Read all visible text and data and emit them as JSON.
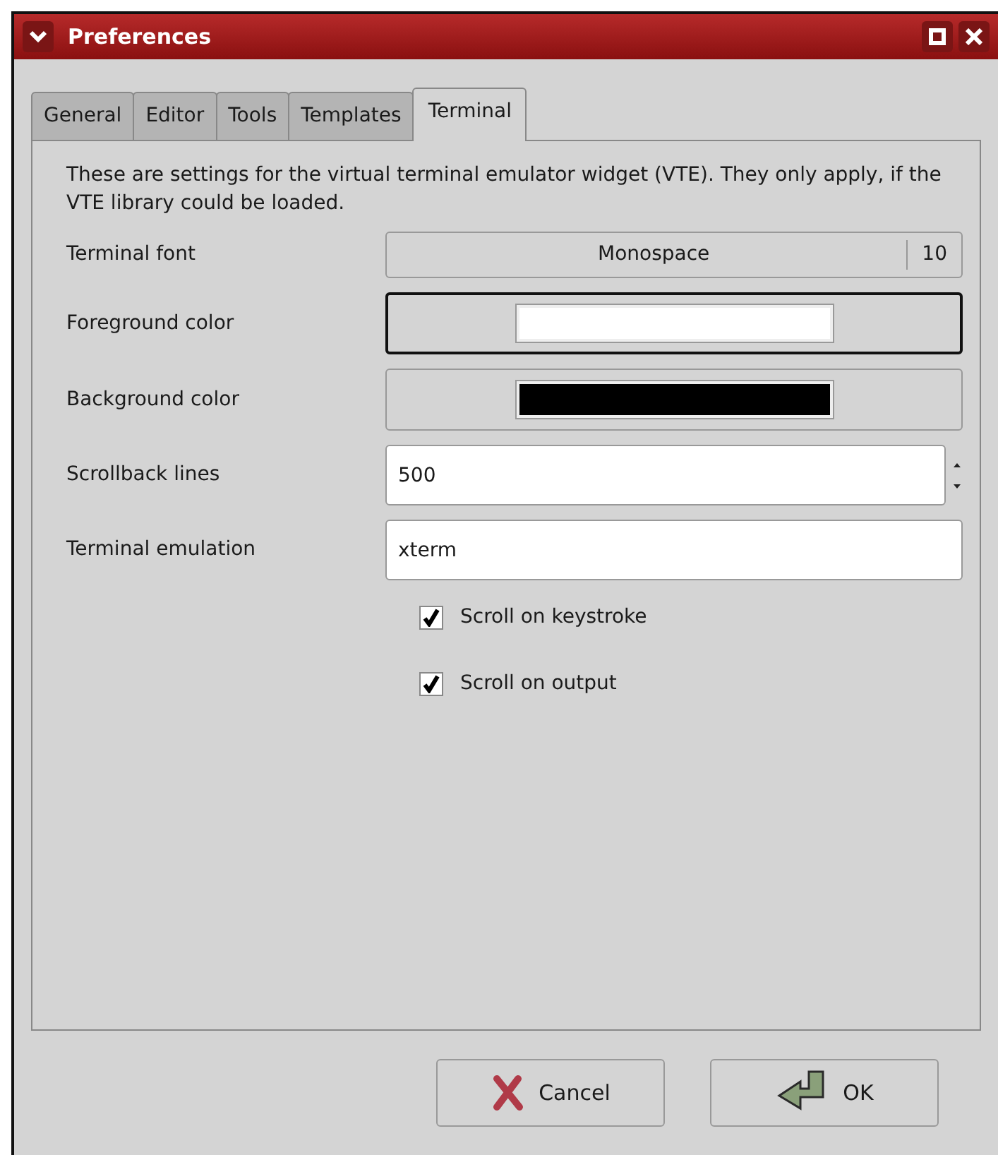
{
  "window": {
    "title": "Preferences"
  },
  "tabs": [
    {
      "label": "General",
      "selected": false
    },
    {
      "label": "Editor",
      "selected": false
    },
    {
      "label": "Tools",
      "selected": false
    },
    {
      "label": "Templates",
      "selected": false
    },
    {
      "label": "Terminal",
      "selected": true
    }
  ],
  "description": "These are settings for the virtual terminal emulator widget (VTE). They only apply, if the VTE library could be loaded.",
  "settings": [
    {
      "kind": "font",
      "label": "Terminal font",
      "font": "Monospace",
      "size": "10"
    },
    {
      "kind": "color",
      "label": "Foreground color",
      "color": "#ffffff",
      "focused": true
    },
    {
      "kind": "color",
      "label": "Background color",
      "color": "#000000",
      "focused": false
    },
    {
      "kind": "spin",
      "label": "Scrollback lines",
      "value": "500"
    },
    {
      "kind": "text",
      "label": "Terminal emulation",
      "value": "xterm"
    }
  ],
  "checkboxes": [
    {
      "label": "Scroll on keystroke",
      "checked": true
    },
    {
      "label": "Scroll on output",
      "checked": true
    }
  ],
  "buttons": [
    {
      "kind": "cancel",
      "label": "Cancel"
    },
    {
      "kind": "ok",
      "label": "OK"
    }
  ]
}
